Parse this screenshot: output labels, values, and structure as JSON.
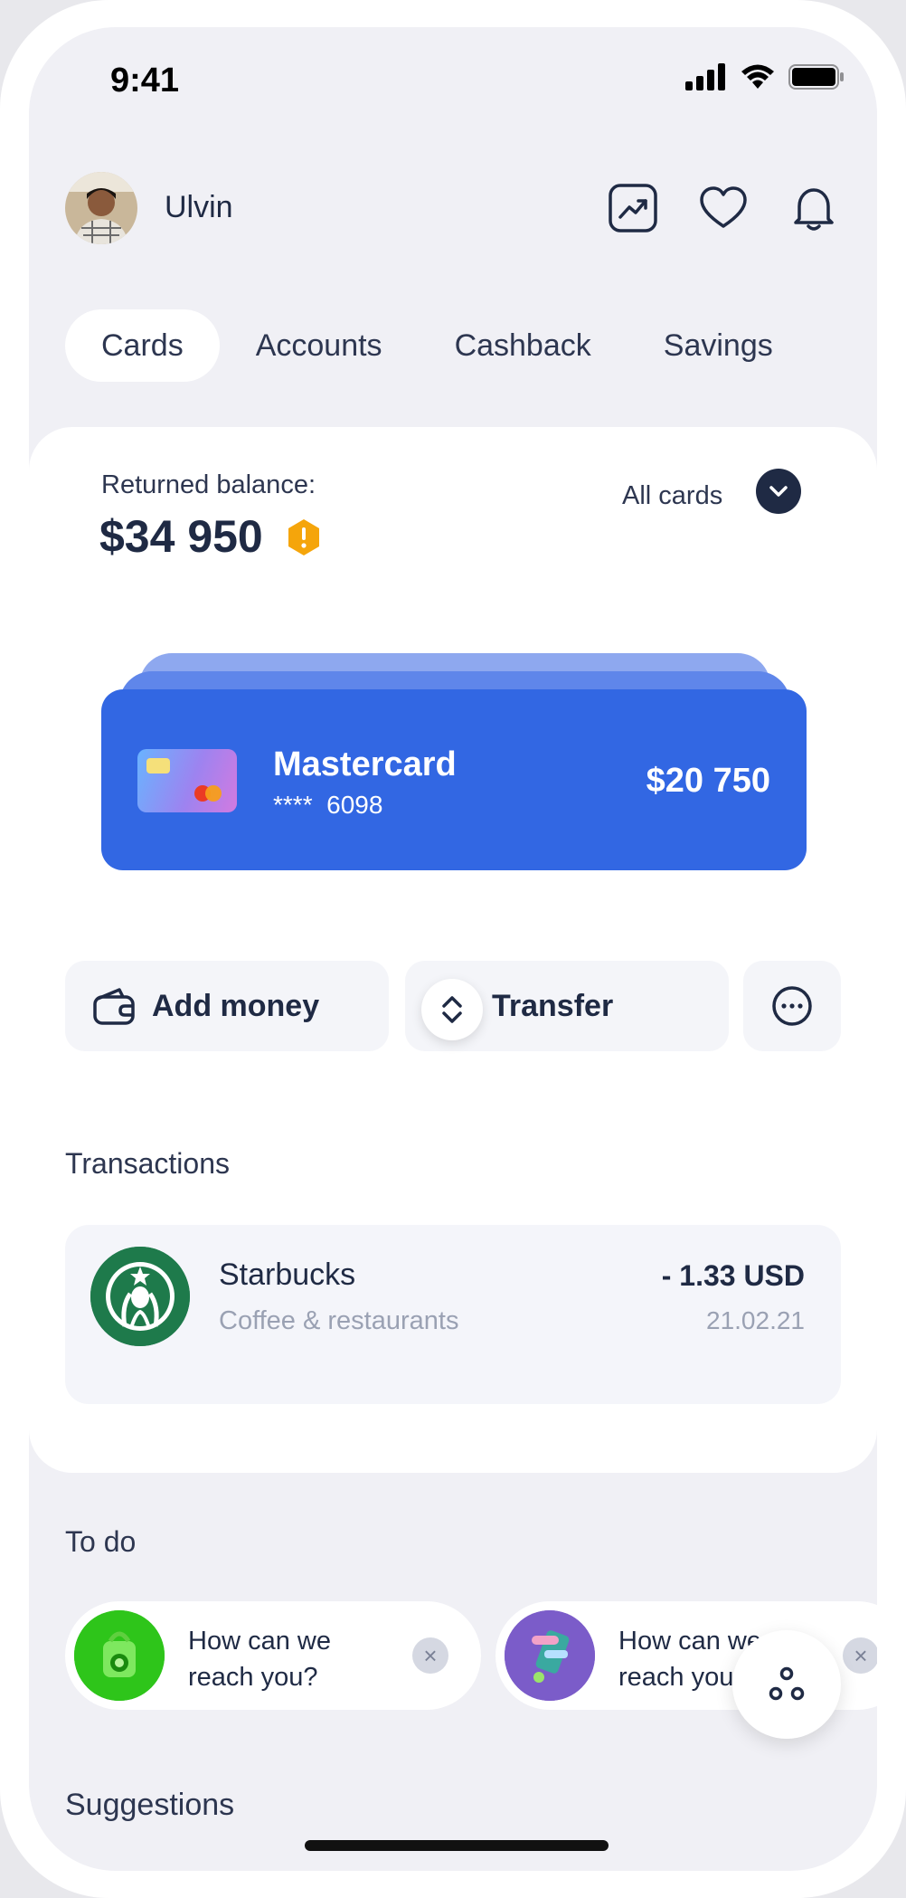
{
  "status_bar": {
    "time": "9:41",
    "icons": [
      "signal-icon",
      "wifi-icon",
      "battery-icon"
    ]
  },
  "header": {
    "username": "Ulvin",
    "icons": [
      "chart-trend-icon",
      "heart-icon",
      "bell-icon"
    ]
  },
  "tabs": [
    {
      "label": "Cards",
      "active": true
    },
    {
      "label": "Accounts",
      "active": false
    },
    {
      "label": "Cashback",
      "active": false
    },
    {
      "label": "Savings",
      "active": false
    }
  ],
  "balance": {
    "label": "Returned balance:",
    "amount": "$34 950",
    "warning_icon": "warning-hex-icon",
    "filter_label": "All cards"
  },
  "card": {
    "name": "Mastercard",
    "number_mask": "****",
    "number_last4": "6098",
    "amount": "$20 750",
    "color": "#3267e3"
  },
  "actions": {
    "add_money": "Add money",
    "transfer": "Transfer"
  },
  "transactions": {
    "title": "Transactions",
    "items": [
      {
        "merchant": "Starbucks",
        "category": "Coffee & restaurants",
        "amount": "- 1.33 USD",
        "date": "21.02.21"
      }
    ]
  },
  "todo": {
    "title": "To do",
    "items": [
      {
        "text": "How can we reach you?"
      },
      {
        "text": "How can we reach you?"
      }
    ]
  },
  "suggestions": {
    "title": "Suggestions"
  },
  "colors": {
    "accent": "#3267e3",
    "text": "#1f2a44",
    "warning": "#f5a50b"
  }
}
